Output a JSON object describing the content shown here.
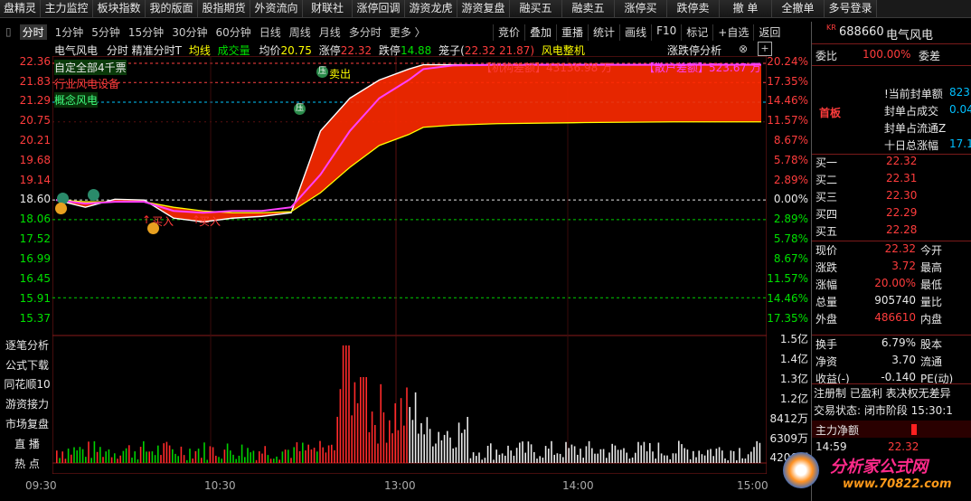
{
  "toolbar": [
    "盘精灵",
    "主力监控",
    "板块指数",
    "我的版面",
    "股指期货",
    "外资流向",
    "财联社",
    "涨停回调",
    "游资龙虎",
    "游资复盘",
    "融买五",
    "融卖五",
    "涨停买",
    "跌停卖",
    "撤 单",
    "全撤单",
    "多号登录"
  ],
  "tabs": [
    "分时",
    "1分钟",
    "5分钟",
    "15分钟",
    "30分钟",
    "60分钟",
    "日线",
    "周线",
    "月线",
    "多分时",
    "更多 〉"
  ],
  "right_tabs": [
    "竞价",
    "叠加",
    "重播",
    "统计",
    "画线",
    "F10",
    "标记",
    "+自选",
    "返回"
  ],
  "header": {
    "name": "电气风电",
    "mode": "分时 精准分时T",
    "avg_line": "均线",
    "volume": "成交量",
    "avg_label": "均价",
    "avg_value": "20.75",
    "limit_up_label": "涨停",
    "limit_up": "22.32",
    "limit_down_label": "跌停",
    "limit_down": "14.88",
    "cage_label": "笼子(",
    "cage_value": "22.32 21.87)",
    "cage_after": "风电整机",
    "analysis": "涨跌停分析"
  },
  "chart_labels": {
    "custom": "自定全部4千票",
    "industry": "行业风电设备",
    "concept": "概念风电",
    "inst_diff": "【机构差额】43136.98 万",
    "retail_diff": "【散户差额】523.67 万",
    "press": "压",
    "sell": "卖出",
    "buy1": "买入",
    "buy2": "买入"
  },
  "left_axis": [
    "22.36",
    "21.83",
    "21.29",
    "20.75",
    "20.21",
    "19.68",
    "19.14",
    "18.60",
    "18.06",
    "17.52",
    "16.99",
    "16.45",
    "15.91",
    "15.37"
  ],
  "right_axis": [
    "20.24%",
    "17.35%",
    "14.46%",
    "11.57%",
    "8.67%",
    "5.78%",
    "2.89%",
    "0.00%",
    "2.89%",
    "5.78%",
    "8.67%",
    "11.57%",
    "14.46%",
    "17.35%"
  ],
  "vol_axis": [
    "1.5亿",
    "1.4亿",
    "1.3亿",
    "1.2亿",
    "8412万",
    "6309万",
    "4206万",
    "21"
  ],
  "side_buttons": [
    "逐笔分析",
    "公式下载",
    "同花顺10",
    "游资接力",
    "市场复盘",
    "直 播",
    "热 点"
  ],
  "time_axis": [
    "09:30",
    "10:30",
    "13:00",
    "14:00",
    "15:00"
  ],
  "chart_data": {
    "type": "line",
    "x": [
      "09:30",
      "09:40",
      "09:50",
      "10:00",
      "10:10",
      "10:20",
      "10:30",
      "10:40",
      "10:50",
      "11:00",
      "11:10",
      "11:20",
      "11:30",
      "13:05",
      "13:15",
      "13:30",
      "14:00",
      "14:30",
      "15:00"
    ],
    "series": [
      {
        "values": [
          18.6,
          18.4,
          18.62,
          18.6,
          18.1,
          18.0,
          18.1,
          18.15,
          18.25,
          20.5,
          21.4,
          21.9,
          22.2,
          22.32,
          22.32,
          22.32,
          22.32,
          22.32,
          22.32
        ]
      },
      {
        "values": [
          18.6,
          18.55,
          18.55,
          18.55,
          18.4,
          18.3,
          18.25,
          18.25,
          18.28,
          18.8,
          19.5,
          20.1,
          20.4,
          20.6,
          20.66,
          20.7,
          20.73,
          20.75,
          20.75
        ]
      }
    ],
    "ylim": [
      15.37,
      22.36
    ]
  },
  "stock": {
    "market": "KR",
    "code": "688660",
    "name": "电气风电"
  },
  "ratio": {
    "label1": "委比",
    "value": "100.00%",
    "label2": "委差"
  },
  "seal": {
    "tag": "首板",
    "items": [
      "!当前封单额",
      "封单占成交",
      "封单占流通Z",
      "十日总涨幅"
    ],
    "values": [
      "823",
      "0.04",
      "",
      "17.1"
    ]
  },
  "bids": [
    {
      "label": "买一",
      "price": "22.32"
    },
    {
      "label": "买二",
      "price": "22.31"
    },
    {
      "label": "买三",
      "price": "22.30"
    },
    {
      "label": "买四",
      "price": "22.29"
    },
    {
      "label": "买五",
      "price": "22.28"
    }
  ],
  "quote": [
    {
      "l": "现价",
      "v": "22.32",
      "l2": "今开"
    },
    {
      "l": "涨跌",
      "v": "3.72",
      "l2": "最高"
    },
    {
      "l": "涨幅",
      "v": "20.00%",
      "l2": "最低"
    },
    {
      "l": "总量",
      "v": "905740",
      "l2": "量比"
    },
    {
      "l": "外盘",
      "v": "486610",
      "l2": "内盘"
    }
  ],
  "quote2": [
    {
      "l": "换手",
      "v": "6.79%",
      "l2": "股本"
    },
    {
      "l": "净资",
      "v": "3.70",
      "l2": "流通"
    },
    {
      "l": "收益(-)",
      "v": "-0.140",
      "l2": "PE(动)"
    }
  ],
  "reg": "注册制 已盈利 表决权无差异",
  "trade_state": "交易状态: 闭市阶段 15:30:1",
  "net_inflow": "主力净额",
  "tick": {
    "time": "14:59",
    "price": "22.32"
  },
  "watermark": {
    "line1": "分析家公式网",
    "line2": "www.70822.com"
  }
}
